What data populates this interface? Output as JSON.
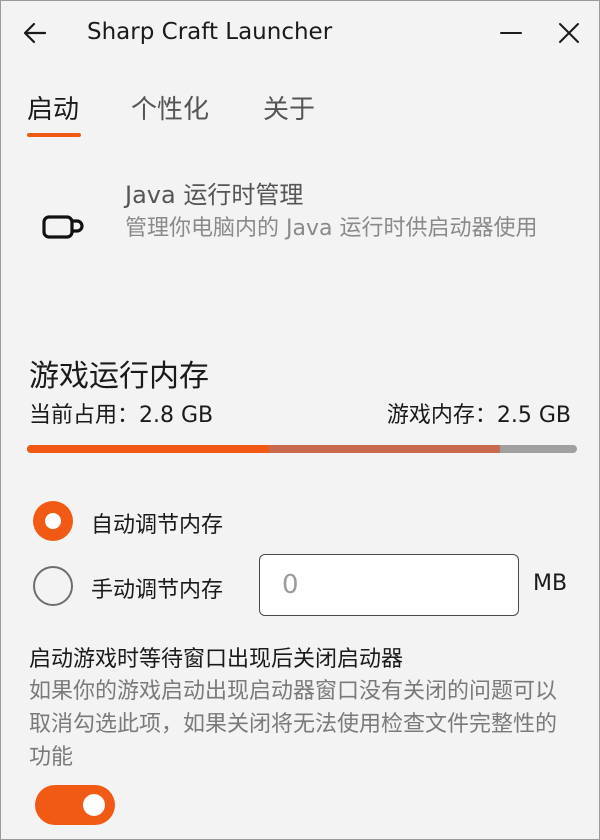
{
  "window": {
    "title": "Sharp Craft Launcher",
    "back_icon": "arrow-left-icon",
    "minimize_icon": "minimize-icon",
    "close_icon": "close-icon"
  },
  "tabs": [
    {
      "label": "启动",
      "active": true
    },
    {
      "label": "个性化",
      "active": false
    },
    {
      "label": "关于",
      "active": false
    }
  ],
  "java": {
    "icon": "cup-icon",
    "title": "Java 运行时管理",
    "description": "管理你电脑内的 Java 运行时供启动器使用"
  },
  "memory": {
    "title": "游戏运行内存",
    "used_text": "当前占用：2.8 GB",
    "game_text": "游戏内存：2.5 GB",
    "used_fraction": 0.44,
    "game_fraction": 0.86,
    "options": [
      {
        "label": "自动调节内存",
        "checked": true
      },
      {
        "label": "手动调节内存",
        "checked": false
      }
    ],
    "manual_placeholder": "0",
    "unit": "MB"
  },
  "close_on_launch": {
    "title": "启动游戏时等待窗口出现后关闭启动器",
    "description": "如果你的游戏启动出现启动器窗口没有关闭的问题可以取消勾选此项，如果关闭将无法使用检查文件完整性的功能",
    "enabled": true
  },
  "colors": {
    "accent": "#f05a14",
    "game_bar": "#c86a4e",
    "track": "#a0a0a0"
  }
}
